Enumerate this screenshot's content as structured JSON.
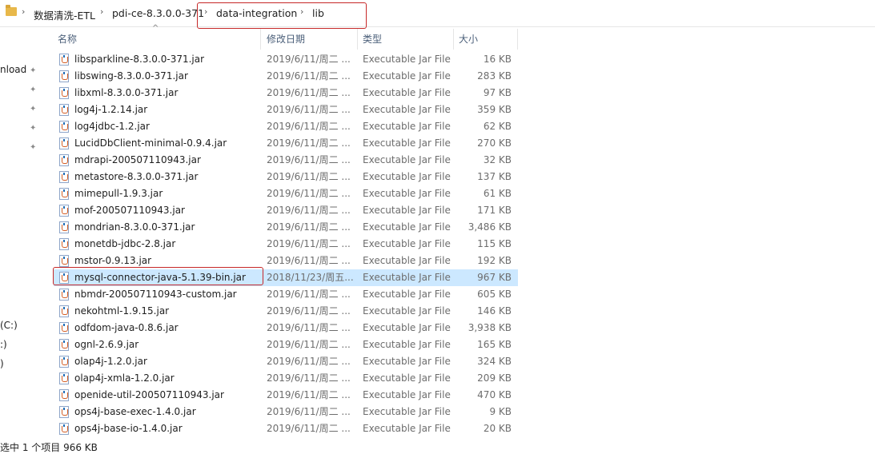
{
  "breadcrumb": {
    "items": [
      "数据清洗-ETL",
      "pdi-ce-8.3.0.0-371",
      "data-integration",
      "lib"
    ],
    "separator": "›"
  },
  "nav": {
    "items": [
      {
        "label": "nload",
        "pinned": true
      },
      {
        "label": "",
        "pinned": true
      },
      {
        "label": "",
        "pinned": true
      },
      {
        "label": "",
        "pinned": true
      },
      {
        "label": "",
        "pinned": true
      },
      {
        "label": "(C:)",
        "pinned": false
      },
      {
        "label": ":)",
        "pinned": false
      },
      {
        "label": ")",
        "pinned": false
      }
    ]
  },
  "columns": {
    "name": "名称",
    "date": "修改日期",
    "type": "类型",
    "size": "大小",
    "sort_indicator": "^"
  },
  "files": [
    {
      "name": "libsparkline-8.3.0.0-371.jar",
      "date": "2019/6/11/周二 ...",
      "type": "Executable Jar File",
      "size": "16 KB"
    },
    {
      "name": "libswing-8.3.0.0-371.jar",
      "date": "2019/6/11/周二 ...",
      "type": "Executable Jar File",
      "size": "283 KB"
    },
    {
      "name": "libxml-8.3.0.0-371.jar",
      "date": "2019/6/11/周二 ...",
      "type": "Executable Jar File",
      "size": "97 KB"
    },
    {
      "name": "log4j-1.2.14.jar",
      "date": "2019/6/11/周二 ...",
      "type": "Executable Jar File",
      "size": "359 KB"
    },
    {
      "name": "log4jdbc-1.2.jar",
      "date": "2019/6/11/周二 ...",
      "type": "Executable Jar File",
      "size": "62 KB"
    },
    {
      "name": "LucidDbClient-minimal-0.9.4.jar",
      "date": "2019/6/11/周二 ...",
      "type": "Executable Jar File",
      "size": "270 KB"
    },
    {
      "name": "mdrapi-200507110943.jar",
      "date": "2019/6/11/周二 ...",
      "type": "Executable Jar File",
      "size": "32 KB"
    },
    {
      "name": "metastore-8.3.0.0-371.jar",
      "date": "2019/6/11/周二 ...",
      "type": "Executable Jar File",
      "size": "137 KB"
    },
    {
      "name": "mimepull-1.9.3.jar",
      "date": "2019/6/11/周二 ...",
      "type": "Executable Jar File",
      "size": "61 KB"
    },
    {
      "name": "mof-200507110943.jar",
      "date": "2019/6/11/周二 ...",
      "type": "Executable Jar File",
      "size": "171 KB"
    },
    {
      "name": "mondrian-8.3.0.0-371.jar",
      "date": "2019/6/11/周二 ...",
      "type": "Executable Jar File",
      "size": "3,486 KB"
    },
    {
      "name": "monetdb-jdbc-2.8.jar",
      "date": "2019/6/11/周二 ...",
      "type": "Executable Jar File",
      "size": "115 KB"
    },
    {
      "name": "mstor-0.9.13.jar",
      "date": "2019/6/11/周二 ...",
      "type": "Executable Jar File",
      "size": "192 KB"
    },
    {
      "name": "mysql-connector-java-5.1.39-bin.jar",
      "date": "2018/11/23/周五...",
      "type": "Executable Jar File",
      "size": "967 KB",
      "selected": true
    },
    {
      "name": "nbmdr-200507110943-custom.jar",
      "date": "2019/6/11/周二 ...",
      "type": "Executable Jar File",
      "size": "605 KB"
    },
    {
      "name": "nekohtml-1.9.15.jar",
      "date": "2019/6/11/周二 ...",
      "type": "Executable Jar File",
      "size": "146 KB"
    },
    {
      "name": "odfdom-java-0.8.6.jar",
      "date": "2019/6/11/周二 ...",
      "type": "Executable Jar File",
      "size": "3,938 KB"
    },
    {
      "name": "ognl-2.6.9.jar",
      "date": "2019/6/11/周二 ...",
      "type": "Executable Jar File",
      "size": "165 KB"
    },
    {
      "name": "olap4j-1.2.0.jar",
      "date": "2019/6/11/周二 ...",
      "type": "Executable Jar File",
      "size": "324 KB"
    },
    {
      "name": "olap4j-xmla-1.2.0.jar",
      "date": "2019/6/11/周二 ...",
      "type": "Executable Jar File",
      "size": "209 KB"
    },
    {
      "name": "openide-util-200507110943.jar",
      "date": "2019/6/11/周二 ...",
      "type": "Executable Jar File",
      "size": "470 KB"
    },
    {
      "name": "ops4j-base-exec-1.4.0.jar",
      "date": "2019/6/11/周二 ...",
      "type": "Executable Jar File",
      "size": "9 KB"
    },
    {
      "name": "ops4j-base-io-1.4.0.jar",
      "date": "2019/6/11/周二 ...",
      "type": "Executable Jar File",
      "size": "20 KB"
    }
  ],
  "status": {
    "text": "选中 1 个项目  966 KB"
  },
  "colors": {
    "selection": "#cce8ff",
    "annotation_box": "#c62828",
    "header_text": "#4c607a"
  }
}
